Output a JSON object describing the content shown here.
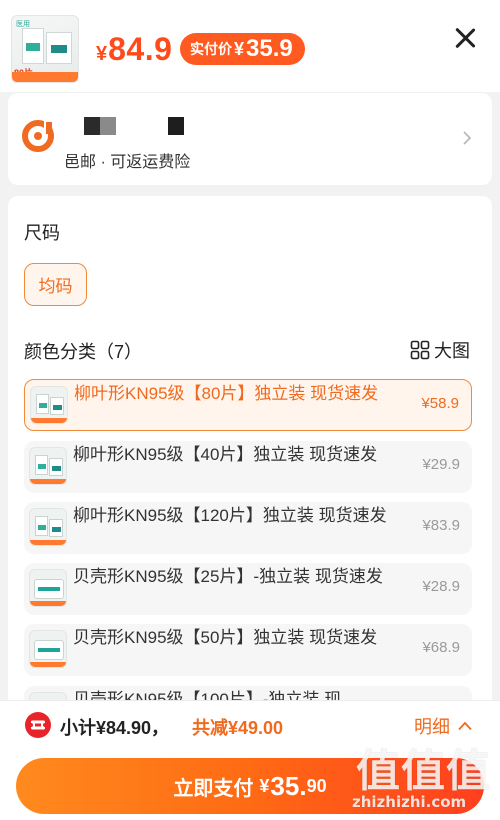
{
  "header": {
    "thumb_badge": "80片",
    "thumb_brand": "医用",
    "price_currency": "¥",
    "price_value": "84.9",
    "paid_label": "实付价",
    "paid_currency": "¥",
    "paid_value": "35.9"
  },
  "address": {
    "line": "邑邮 · 可返运费险"
  },
  "size": {
    "title": "尺码",
    "options": [
      "均码"
    ],
    "selected": "均码"
  },
  "color": {
    "title": "颜色分类（7）",
    "bigview_label": "大图",
    "options": [
      {
        "name": "柳叶形KN95级【80片】独立装 现货速发",
        "price": "¥58.9",
        "selected": true
      },
      {
        "name": "柳叶形KN95级【40片】独立装 现货速发",
        "price": "¥29.9",
        "selected": false
      },
      {
        "name": "柳叶形KN95级【120片】独立装 现货速发",
        "price": "¥83.9",
        "selected": false
      },
      {
        "name": "贝壳形KN95级【25片】-独立装 现货速发",
        "price": "¥28.9",
        "selected": false
      },
      {
        "name": "贝壳形KN95级【50片】独立装 现货速发",
        "price": "¥68.9",
        "selected": false
      },
      {
        "name": "贝壳形KN95级【100片】-独立装 现",
        "price": "",
        "selected": false
      }
    ]
  },
  "footer": {
    "subtotal": "小计¥84.90，",
    "discount": "共减¥49.00",
    "detail_label": "明细",
    "pay_label": "立即支付",
    "pay_currency": "¥",
    "pay_int": "35.",
    "pay_dec": "90"
  },
  "watermark": {
    "logo": "值值值",
    "url": "zhizhizhi.com"
  },
  "colors": {
    "accent": "#f06a1f",
    "price_red": "#ff4a1a",
    "selected_bg": "#fff5ec"
  },
  "icons": [
    "close-icon",
    "location-icon",
    "chevron-right-icon",
    "grid-icon",
    "ticket-icon",
    "chevron-up-icon"
  ]
}
